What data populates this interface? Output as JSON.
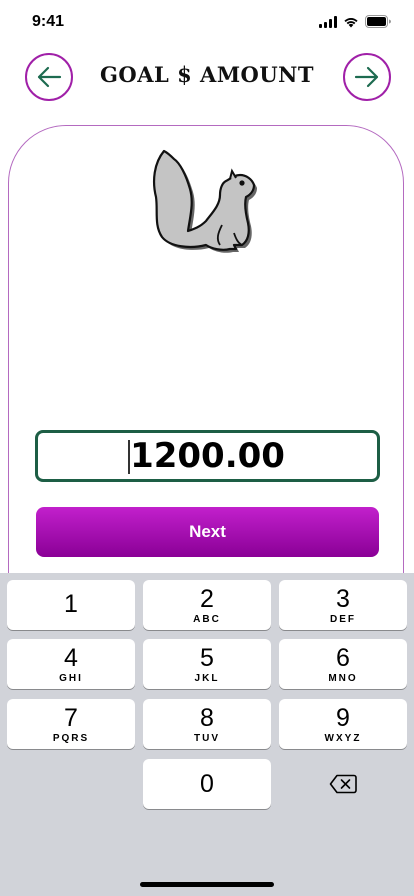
{
  "status_bar": {
    "time": "9:41"
  },
  "header": {
    "title": "GOAL $ AMOUNT",
    "back_icon": "arrow-left-icon",
    "forward_icon": "arrow-right-icon"
  },
  "form": {
    "amount_value": "1200.00",
    "next_label": "Next"
  },
  "keyboard": {
    "keys": [
      {
        "digit": "1",
        "letters": ""
      },
      {
        "digit": "2",
        "letters": "ABC"
      },
      {
        "digit": "3",
        "letters": "DEF"
      },
      {
        "digit": "4",
        "letters": "GHI"
      },
      {
        "digit": "5",
        "letters": "JKL"
      },
      {
        "digit": "6",
        "letters": "MNO"
      },
      {
        "digit": "7",
        "letters": "PQRS"
      },
      {
        "digit": "8",
        "letters": "TUV"
      },
      {
        "digit": "9",
        "letters": "WXYZ"
      },
      {
        "digit": "0",
        "letters": ""
      }
    ],
    "delete_icon": "backspace-icon"
  },
  "colors": {
    "accent": "#a020a8",
    "button_top": "#c220cc",
    "button_bottom": "#8a0096",
    "field_border": "#1d5e45",
    "arrow": "#1d6b50",
    "keyboard_bg": "#d1d3d9"
  }
}
